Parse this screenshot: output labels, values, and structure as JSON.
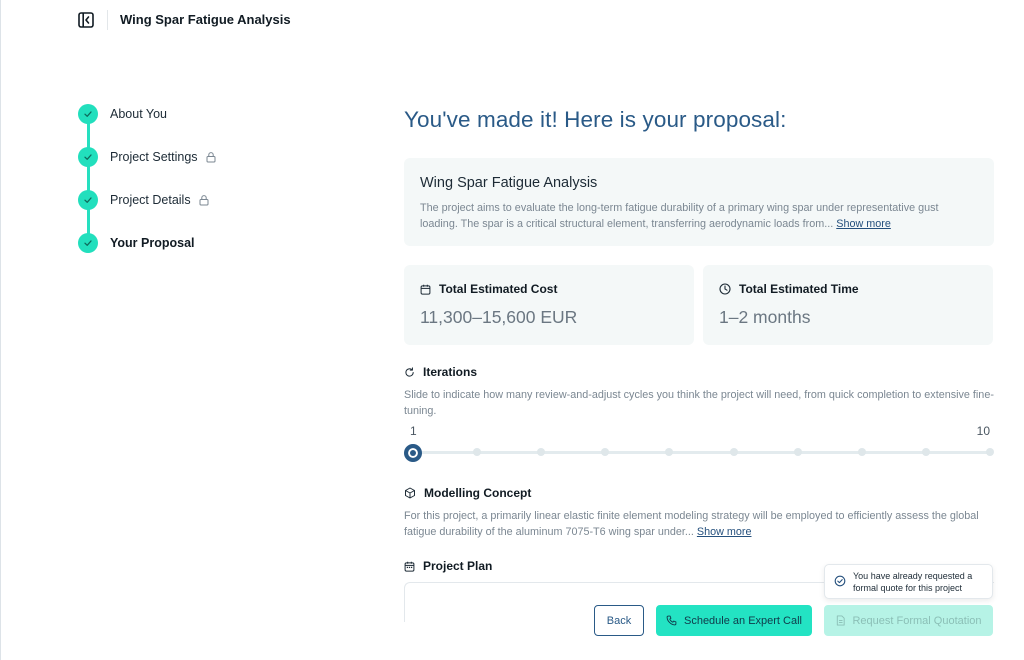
{
  "app": {
    "title": "Wing Spar Fatigue Analysis"
  },
  "stepper": {
    "steps": [
      {
        "label": "About You",
        "completed": true,
        "locked": false,
        "active": false
      },
      {
        "label": "Project Settings",
        "completed": true,
        "locked": true,
        "active": false
      },
      {
        "label": "Project Details",
        "completed": true,
        "locked": true,
        "active": false
      },
      {
        "label": "Your Proposal",
        "completed": true,
        "locked": false,
        "active": true
      }
    ]
  },
  "main": {
    "headline": "You've made it! Here is your proposal:",
    "summary": {
      "title": "Wing Spar Fatigue Analysis",
      "text": "The project aims to evaluate the long-term fatigue durability of a primary wing spar under representative gust loading. The spar is a critical structural element, transferring aerodynamic loads from...",
      "show_more": "Show more"
    },
    "cost": {
      "label": "Total Estimated Cost",
      "value": "11,300–15,600 EUR"
    },
    "time": {
      "label": "Total Estimated Time",
      "value": "1–2 months"
    },
    "iterations": {
      "label": "Iterations",
      "description": "Slide to indicate how many review-and-adjust cycles you think the project will need, from quick completion to extensive fine-tuning.",
      "min_label": "1",
      "max_label": "10",
      "min": 1,
      "max": 10,
      "value": 1
    },
    "modelling": {
      "label": "Modelling Concept",
      "text": "For this project, a primarily linear elastic finite element modeling strategy will be employed to efficiently assess the global fatigue durability of the aluminum 7075-T6 wing spar under...",
      "show_more": "Show more"
    },
    "plan": {
      "label": "Project Plan"
    }
  },
  "tooltip": {
    "text": "You have already requested a formal quote for this project"
  },
  "actions": {
    "back": "Back",
    "schedule": "Schedule an Expert Call",
    "request": "Request Formal Quotation"
  },
  "colors": {
    "accent": "#23e3c3",
    "primary": "#2a5a87",
    "card_bg": "#f4f8f8"
  },
  "icons": {
    "collapse": "sidebar-collapse-icon",
    "check": "check-icon",
    "lock": "lock-icon",
    "calendar": "calendar-icon",
    "clock": "clock-icon",
    "iterations": "refresh-icon",
    "modelling": "cube-icon",
    "plan": "calendar-icon",
    "phone": "phone-icon",
    "document": "document-icon",
    "info": "check-circle-icon"
  }
}
